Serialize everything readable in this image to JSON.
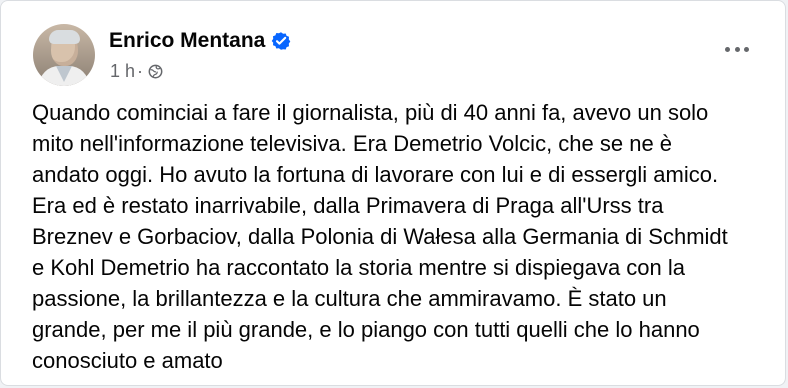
{
  "post": {
    "author": "Enrico Mentana",
    "time": "1 h",
    "separator": "·",
    "text": "Quando cominciai a fare il giornalista, più di 40 anni fa, avevo un solo\nmito nell'informazione televisiva. Era Demetrio Volcic, che se ne è\nandato oggi. Ho avuto la fortuna di lavorare con lui e di essergli amico.\nEra ed è restato inarrivabile, dalla Primavera di Praga all'Urss tra\nBreznev e Gorbaciov, dalla Polonia di Wałesa alla Germania di Schmidt\ne Kohl Demetrio ha raccontato la storia mentre si dispiegava con la\npassione, la brillantezza e la cultura che ammiravamo. È stato un\ngrande, per me il più grande, e lo piango con tutti quelli che lo hanno\nconosciuto e amato"
  },
  "icons": {
    "verified": "verified-badge-icon",
    "privacy": "globe-icon",
    "menu": "more-options-icon"
  },
  "colors": {
    "verified": "#0866ff",
    "secondary": "#65676b",
    "text": "#050505"
  }
}
